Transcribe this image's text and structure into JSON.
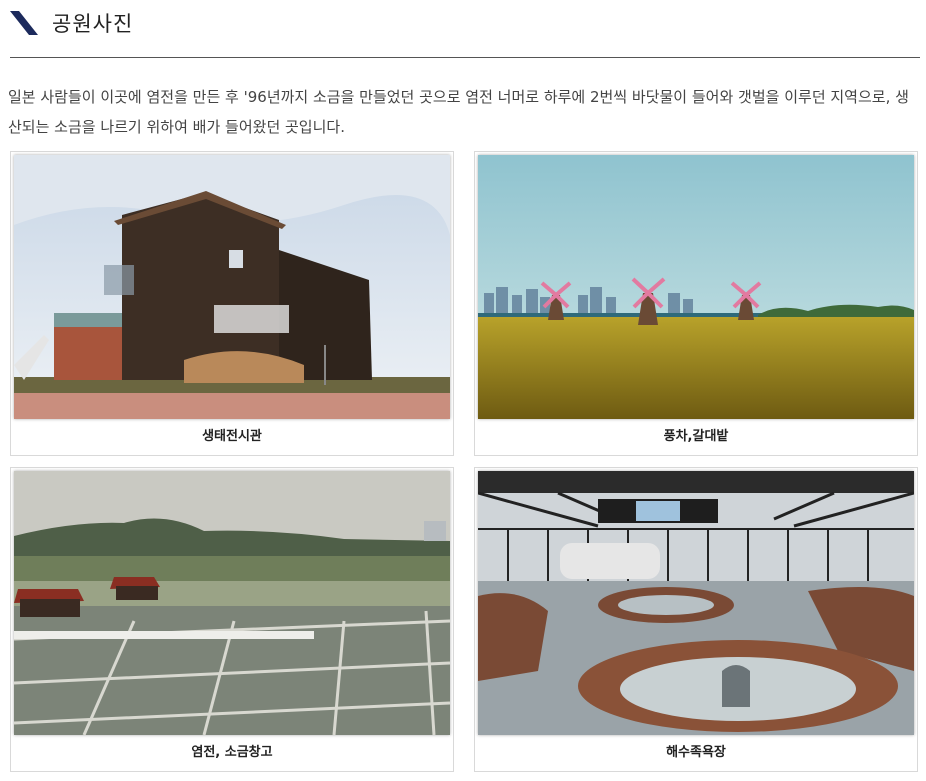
{
  "header": {
    "title": "공원사진"
  },
  "description": "일본 사람들이 이곳에 염전을 만든 후 '96년까지 소금을 만들었던 곳으로 염전 너머로 하루에 2번씩 바닷물이 들어와 갯벌을 이루던 지역으로, 생산되는 소금을 나르기 위하여 배가 들어왔던 곳입니다.",
  "photos": [
    {
      "caption": "생태전시관"
    },
    {
      "caption": "풍차,갈대밭"
    },
    {
      "caption": "염전, 소금창고"
    },
    {
      "caption": "해수족욕장"
    }
  ]
}
